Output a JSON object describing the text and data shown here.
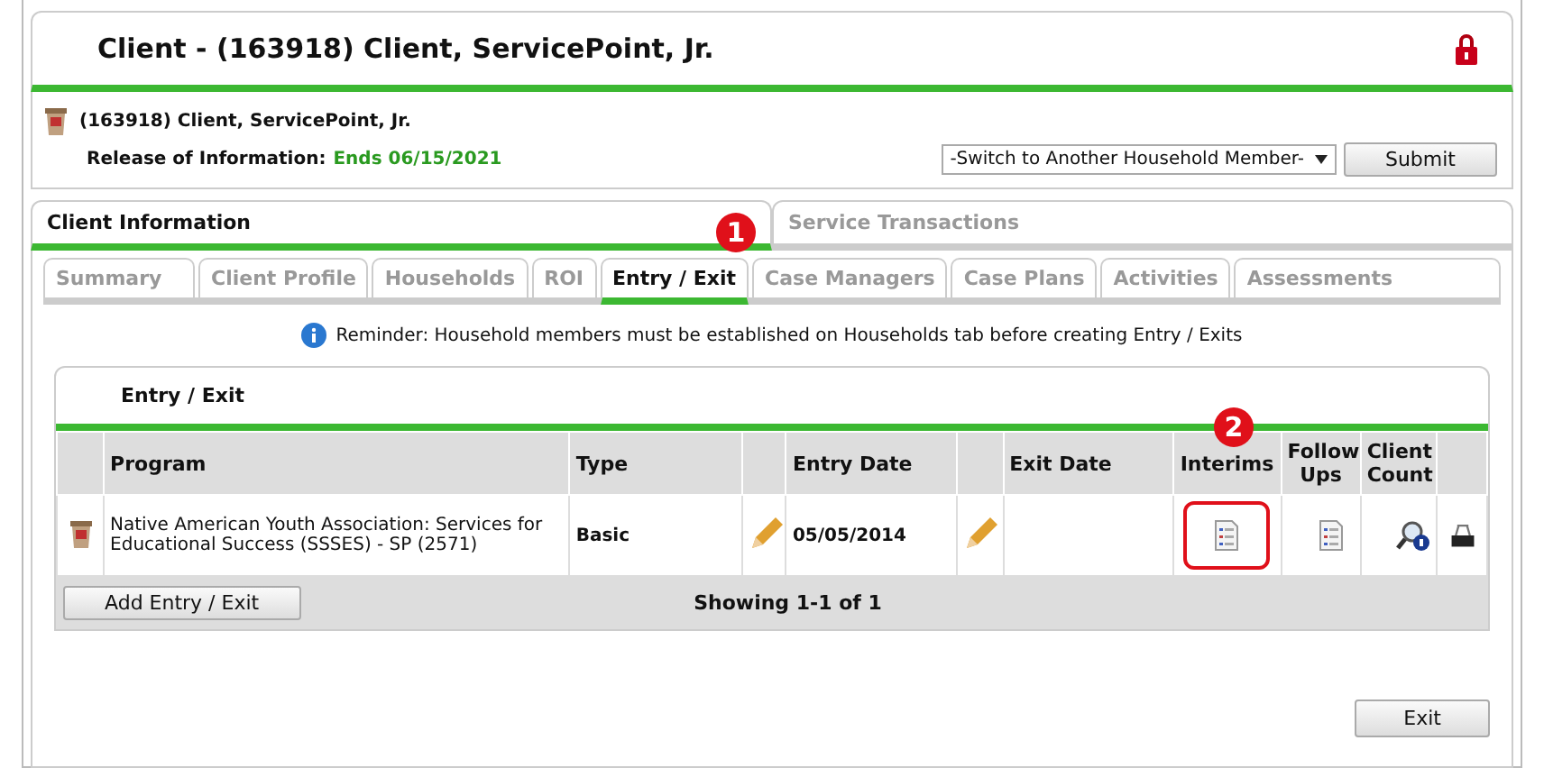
{
  "header": {
    "title": "Client - (163918) Client, ServicePoint, Jr."
  },
  "client": {
    "name": "(163918) Client, ServicePoint, Jr.",
    "roi_label": "Release of Information:",
    "roi_value": "Ends 06/15/2021"
  },
  "household_select": {
    "value": "-Switch to Another Household Member-"
  },
  "submit_button": "Submit",
  "main_tabs": [
    {
      "label": "Client Information",
      "selected": true
    },
    {
      "label": "Service Transactions",
      "selected": false
    }
  ],
  "sub_tabs": [
    {
      "label": "Summary",
      "selected": false
    },
    {
      "label": "Client Profile",
      "selected": false
    },
    {
      "label": "Households",
      "selected": false
    },
    {
      "label": "ROI",
      "selected": false
    },
    {
      "label": "Entry / Exit",
      "selected": true
    },
    {
      "label": "Case Managers",
      "selected": false
    },
    {
      "label": "Case Plans",
      "selected": false
    },
    {
      "label": "Activities",
      "selected": false
    },
    {
      "label": "Assessments",
      "selected": false
    }
  ],
  "reminder": "Reminder: Household members must be established on Households tab before creating Entry / Exits",
  "panel": {
    "title": "Entry / Exit",
    "columns": [
      "Program",
      "Type",
      "Entry Date",
      "Exit Date",
      "Interims",
      "Follow Ups",
      "Client Count"
    ],
    "rows": [
      {
        "program": "Native American Youth Association: Services for Educational Success (SSSES) - SP (2571)",
        "type": "Basic",
        "entry_date": "05/05/2014",
        "actions": [
          {
            "kind": "interims",
            "highlighted": true
          },
          {
            "kind": "follow_ups",
            "highlighted": false
          },
          {
            "kind": "client_count",
            "highlighted": false
          },
          {
            "kind": "attachments",
            "highlighted": false
          }
        ]
      }
    ],
    "add_button": "Add Entry / Exit",
    "showing": "Showing 1-1 of 1"
  },
  "exit_button": "Exit",
  "callouts": [
    "1",
    "2"
  ]
}
